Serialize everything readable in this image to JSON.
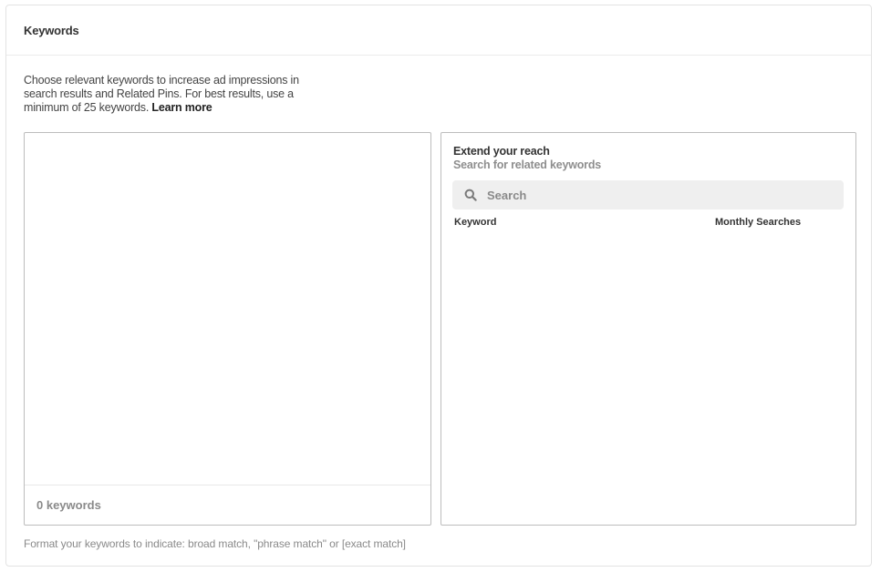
{
  "card": {
    "title": "Keywords"
  },
  "intro": {
    "text": "Choose relevant keywords to increase ad impressions in search results and Related Pins. For best results, use a minimum of 25 keywords.",
    "learn_more": "Learn more"
  },
  "keywords_panel": {
    "value": "",
    "count_label": "0 keywords"
  },
  "extend_panel": {
    "title": "Extend your reach",
    "subtitle": "Search for related keywords",
    "search": {
      "placeholder": "Search",
      "value": "",
      "icon": "search-icon"
    },
    "columns": [
      "Keyword",
      "Monthly Searches"
    ],
    "rows": []
  },
  "format_hint": "Format your keywords to indicate: broad match, \"phrase match\" or [exact match]",
  "colors": {
    "border": "#bdbdbd",
    "search_bg": "#efefef",
    "muted_text": "#8a8a8a"
  }
}
